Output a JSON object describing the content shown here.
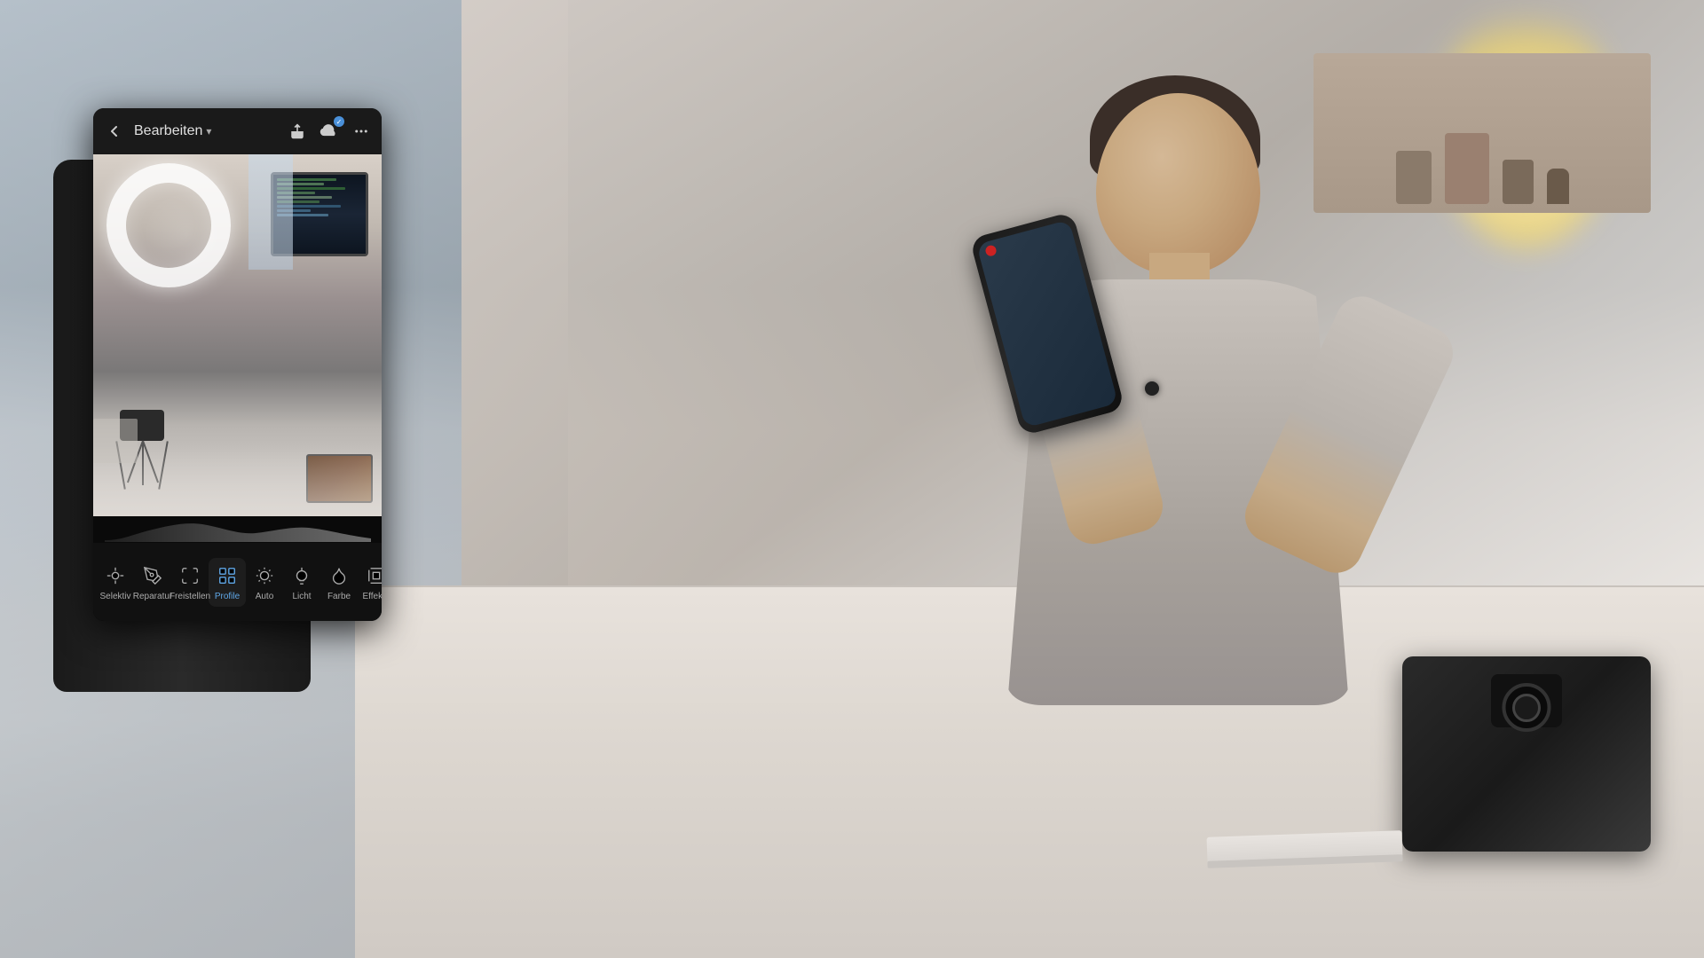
{
  "scene": {
    "background_color": "#1a1a1a"
  },
  "phone_ui": {
    "header": {
      "back_label": "‹",
      "title": "Bearbeiten",
      "title_chevron": "▾",
      "share_icon": "share",
      "cloud_icon": "cloud",
      "more_icon": "..."
    },
    "toolbar": {
      "items": [
        {
          "id": "selektiv",
          "label": "Selektiv",
          "icon": "cursor"
        },
        {
          "id": "reparatur",
          "label": "Reparatur",
          "icon": "bandaid"
        },
        {
          "id": "freistellen",
          "label": "Freistellen",
          "icon": "crop"
        },
        {
          "id": "profile",
          "label": "Profile",
          "icon": "grid",
          "active": true
        },
        {
          "id": "auto",
          "label": "Auto",
          "icon": "auto"
        },
        {
          "id": "licht",
          "label": "Licht",
          "icon": "sun"
        },
        {
          "id": "farbe",
          "label": "Farbe",
          "icon": "droplet"
        },
        {
          "id": "effekte",
          "label": "Effekte",
          "icon": "sparkle"
        }
      ]
    }
  }
}
